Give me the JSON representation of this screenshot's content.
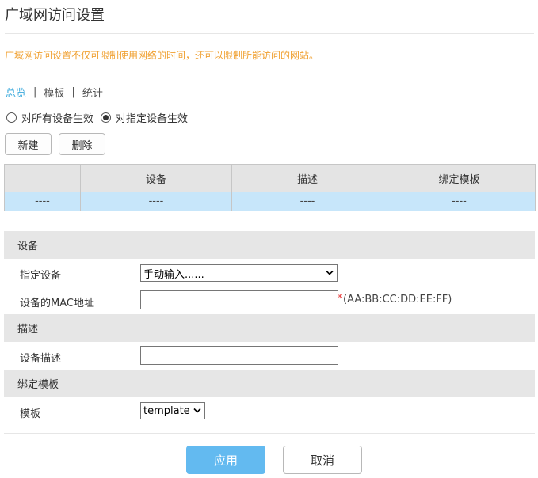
{
  "page": {
    "title": "广域网访问设置",
    "notice": "广域网访问设置不仅可限制使用网络的时间，还可以限制所能访问的网站。"
  },
  "subnav": {
    "items": [
      {
        "label": "总览",
        "active": true
      },
      {
        "label": "模板",
        "active": false
      },
      {
        "label": "统计",
        "active": false
      }
    ],
    "separator": "|"
  },
  "scope": {
    "options": [
      {
        "label": "对所有设备生效",
        "checked": false
      },
      {
        "label": "对指定设备生效",
        "checked": true
      }
    ]
  },
  "toolbar": {
    "new_label": "新建",
    "delete_label": "删除"
  },
  "table": {
    "columns": [
      "",
      "设备",
      "描述",
      "绑定模板"
    ],
    "rows": [
      [
        "----",
        "----",
        "----",
        "----"
      ]
    ]
  },
  "form": {
    "device_section": {
      "title": "设备",
      "device_label": "指定设备",
      "device_value": "手动输入......",
      "mac_label": "设备的MAC地址",
      "mac_value": "",
      "mac_required": "*",
      "mac_hint": "(AA:BB:CC:DD:EE:FF)"
    },
    "desc_section": {
      "title": "描述",
      "desc_label": "设备描述",
      "desc_value": ""
    },
    "template_section": {
      "title": "绑定模板",
      "template_label": "模板",
      "template_value": "template"
    }
  },
  "actions": {
    "apply_label": "应用",
    "cancel_label": "取消"
  },
  "colors": {
    "notice": "#f0a030",
    "active_link": "#39a9dc",
    "table_row": "#c7e6fa",
    "apply_button": "#63baf0",
    "required_mark": "#e53030"
  }
}
